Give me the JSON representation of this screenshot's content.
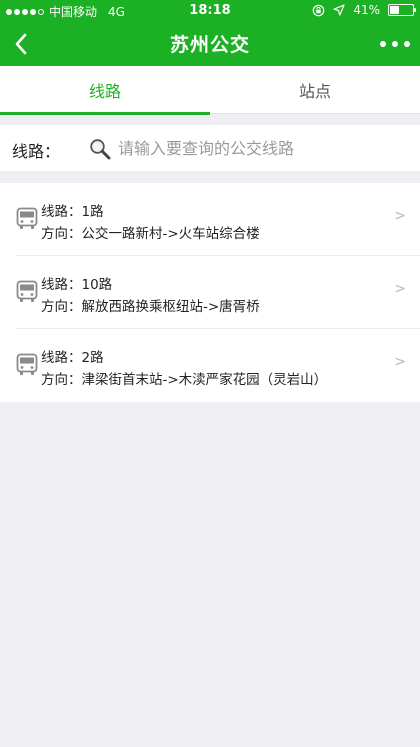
{
  "status_bar": {
    "carrier": "中国移动",
    "network": "4G",
    "time": "18:18",
    "battery": "41%",
    "battery_level": 0.41
  },
  "header": {
    "title": "苏州公交"
  },
  "tabs": [
    {
      "label": "线路",
      "active": true
    },
    {
      "label": "站点",
      "active": false
    }
  ],
  "search": {
    "label": "线路：",
    "placeholder": "请输入要查询的公交线路"
  },
  "routes": [
    {
      "route": "线路：1路",
      "direction": "方向：公交一路新村->火车站综合楼"
    },
    {
      "route": "线路：10路",
      "direction": "方向：解放西路换乘枢纽站->唐胥桥"
    },
    {
      "route": "线路：2路",
      "direction": "方向：津梁街首末站->木渎严家花园（灵岩山）"
    }
  ],
  "row_arrow": ">",
  "colors": {
    "brand": "#1cb024",
    "background": "#eeeef3"
  }
}
